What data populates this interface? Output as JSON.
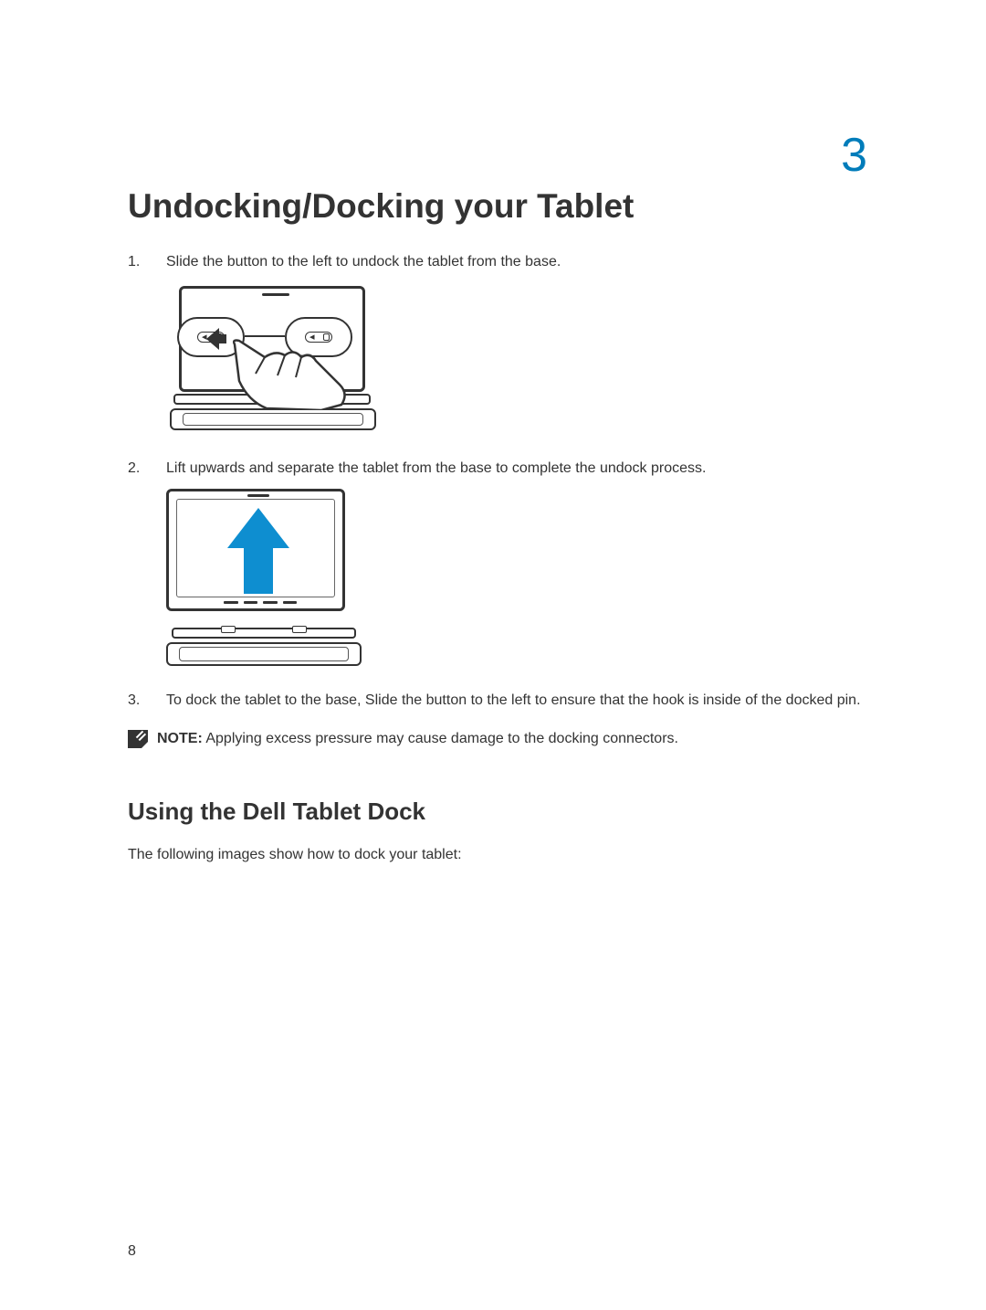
{
  "chapter_number": "3",
  "title": "Undocking/Docking your Tablet",
  "steps": [
    {
      "text": "Slide the button to the left to undock the tablet from the base."
    },
    {
      "text": "Lift upwards and separate the tablet from the base to complete the undock process."
    },
    {
      "text": "To dock the tablet to the base, Slide the button to the left to ensure that the hook is inside of the docked pin."
    }
  ],
  "note": {
    "label": "NOTE:",
    "text": " Applying excess pressure may cause damage to the docking connectors."
  },
  "section2": {
    "heading": "Using the Dell Tablet Dock",
    "intro": "The following images show how to dock your tablet:"
  },
  "page_number": "8"
}
